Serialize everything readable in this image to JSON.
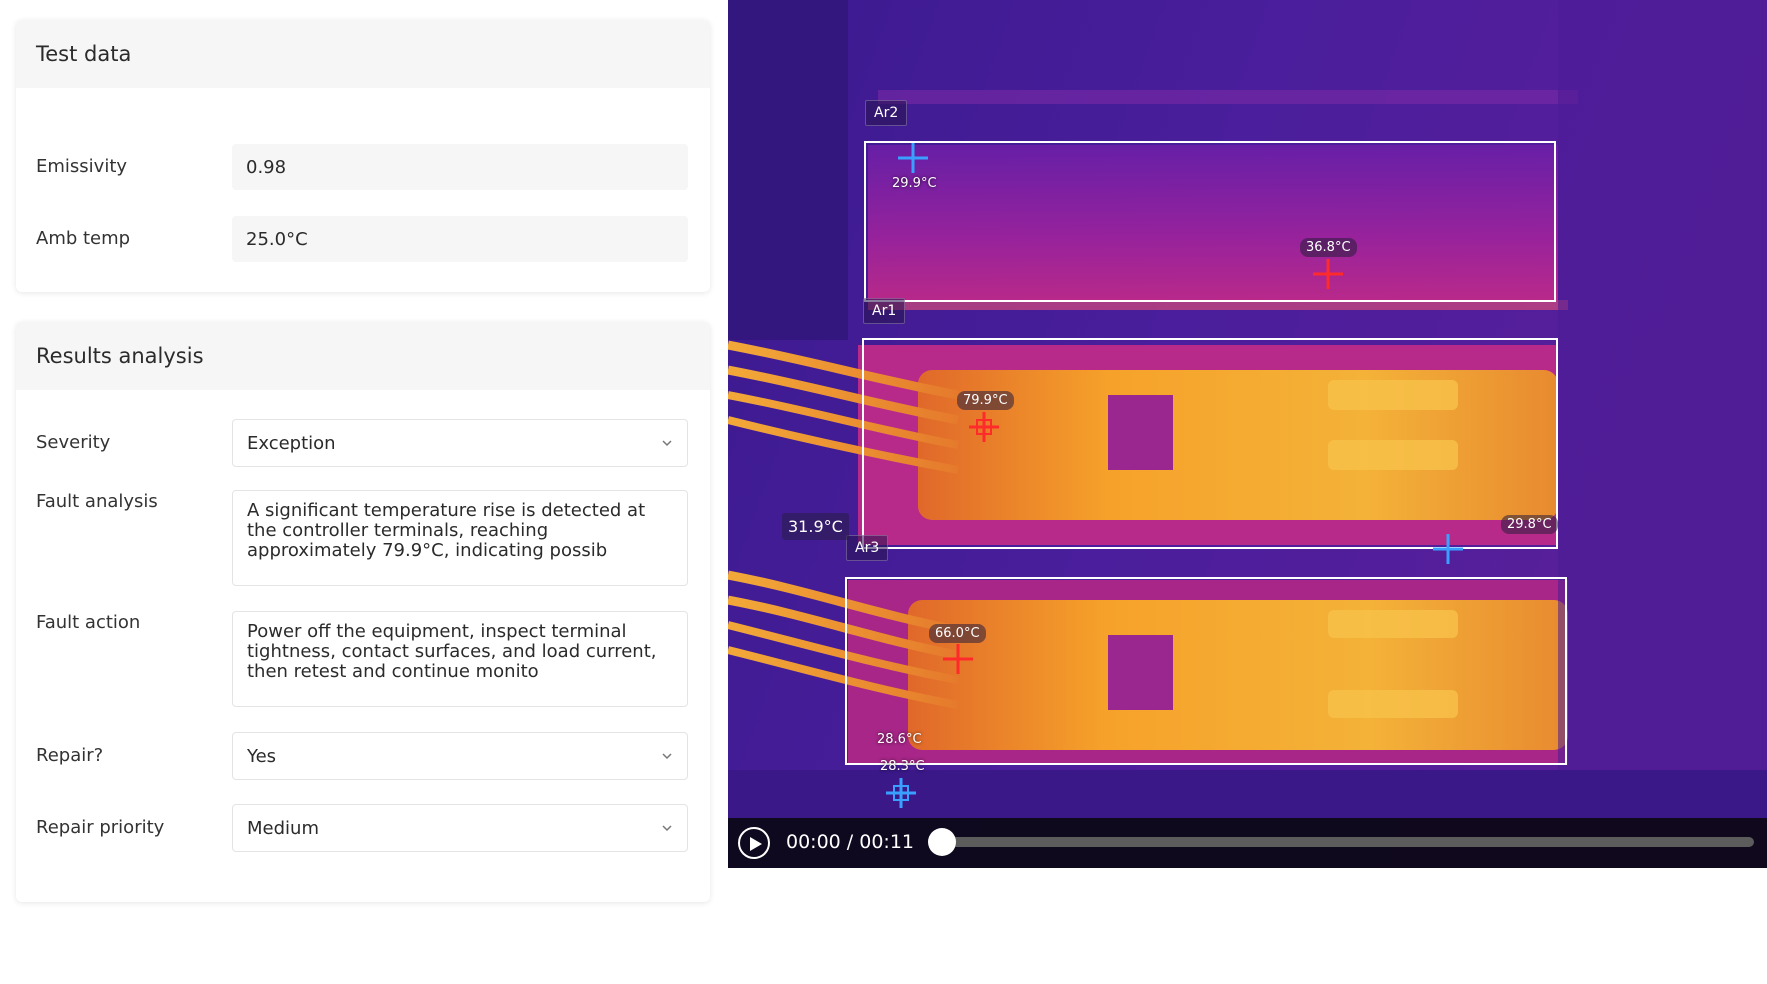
{
  "test_data": {
    "title": "Test data",
    "emissivity_label": "Emissivity",
    "emissivity_value": "0.98",
    "amb_temp_label": "Amb temp",
    "amb_temp_value": "25.0°C"
  },
  "results": {
    "title": "Results analysis",
    "severity_label": "Severity",
    "severity_value": "Exception",
    "fault_analysis_label": "Fault analysis",
    "fault_analysis_value": "A significant temperature rise is detected at the controller terminals, reaching approximately 79.9°C, indicating possib",
    "fault_action_label": "Fault action",
    "fault_action_value": "Power off the equipment, inspect terminal tightness, contact surfaces, and load current, then retest and continue monito",
    "repair_label": "Repair?",
    "repair_value": "Yes",
    "priority_label": "Repair priority",
    "priority_value": "Medium"
  },
  "thermal": {
    "areas": {
      "ar2": "Ar2",
      "ar1": "Ar1",
      "ar3": "Ar3"
    },
    "readings": {
      "ar2_min": "29.9°C",
      "ar2_max": "36.8°C",
      "ar1_max": "79.9°C",
      "left_edge": "31.9°C",
      "ar1_min": "29.8°C",
      "ar3_max": "66.0°C",
      "ar3_min_a": "28.6°C",
      "ar3_min_b": "28.3°C"
    },
    "colors": {
      "cold_marker": "#3aa0ff",
      "hot_marker": "#ff2a2a"
    }
  },
  "player": {
    "time": "00:00 / 00:11",
    "progress": 0.0
  }
}
